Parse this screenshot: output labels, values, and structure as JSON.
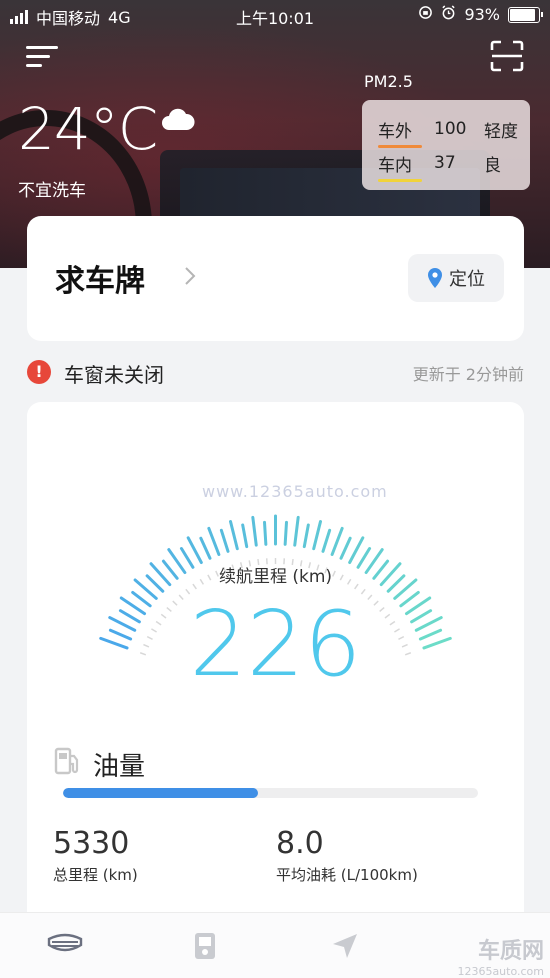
{
  "status_bar": {
    "carrier": "中国移动",
    "network": "4G",
    "time": "上午10:01",
    "battery": "93%"
  },
  "weather": {
    "temperature": "24°C",
    "wash_advice": "不宜洗车"
  },
  "air_quality": {
    "title": "PM2.5",
    "rows": [
      {
        "label": "车外",
        "value": "100",
        "level": "轻度",
        "color": "#f08a3a"
      },
      {
        "label": "车内",
        "value": "37",
        "level": "良",
        "color": "#f1d33a"
      }
    ]
  },
  "plate_card": {
    "title": "求车牌",
    "locate_label": "定位"
  },
  "alert": {
    "text": "车窗未关闭",
    "updated": "更新于 2分钟前"
  },
  "range": {
    "watermark": "www.12365auto.com",
    "label": "续航里程 (km)",
    "value": "226",
    "gauge_colors": [
      "#4aa8ea",
      "#6cdcc8"
    ]
  },
  "fuel": {
    "label": "油量",
    "level": 0.47
  },
  "stats": [
    {
      "value": "5330",
      "label": "总里程 (km)"
    },
    {
      "value": "8.0",
      "label": "平均油耗 (L/100km)"
    }
  ],
  "bottom_nav": {
    "items": [
      "car-logo-icon",
      "device-icon",
      "navigation-arrow-icon"
    ],
    "watermark": {
      "brand": "车质网",
      "url": "12365auto.com"
    }
  }
}
